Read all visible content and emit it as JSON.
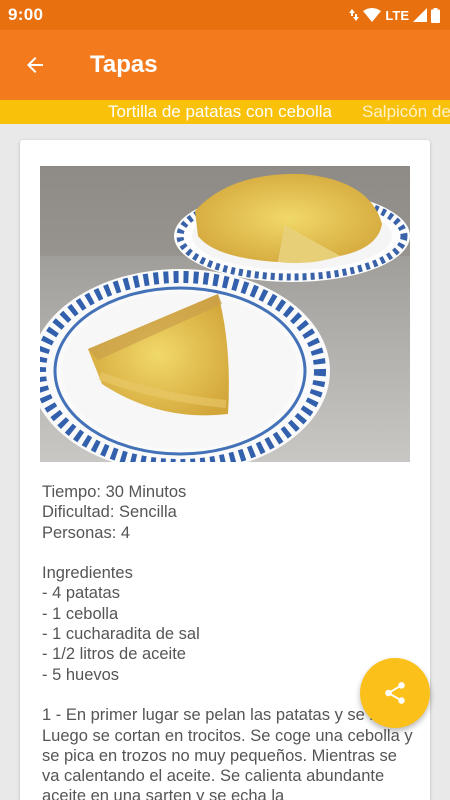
{
  "status_bar": {
    "time": "9:00",
    "network": "LTE"
  },
  "app_bar": {
    "title": "Tapas"
  },
  "tabs": [
    {
      "label": "Tortilla de patatas con cebolla",
      "active": true
    },
    {
      "label": "Salpicón de",
      "active": false
    }
  ],
  "recipe": {
    "tiempo": "Tiempo: 30 Minutos",
    "dificultad": "Dificultad: Sencilla",
    "personas": "Personas: 4",
    "ingredientes_title": "Ingredientes",
    "ingredients": [
      "- 4 patatas",
      "- 1 cebolla",
      "- 1 cucharadita de sal",
      "- 1/2 litros de aceite",
      "- 5 huevos"
    ],
    "steps_text": "1 - En primer lugar se pelan las patatas y se lavan. Luego se cortan en trocitos. Se coge una cebolla y se pica en trozos no muy pequeños. Mientras se va calentando el aceite. Se calienta abundante aceite en una sarten y se echa la"
  },
  "fab": {
    "icon": "share-icon"
  },
  "colors": {
    "primary": "#f47b1d",
    "status": "#e8700f",
    "accent": "#fbc01a",
    "tab_strip": "#f9c10a"
  }
}
